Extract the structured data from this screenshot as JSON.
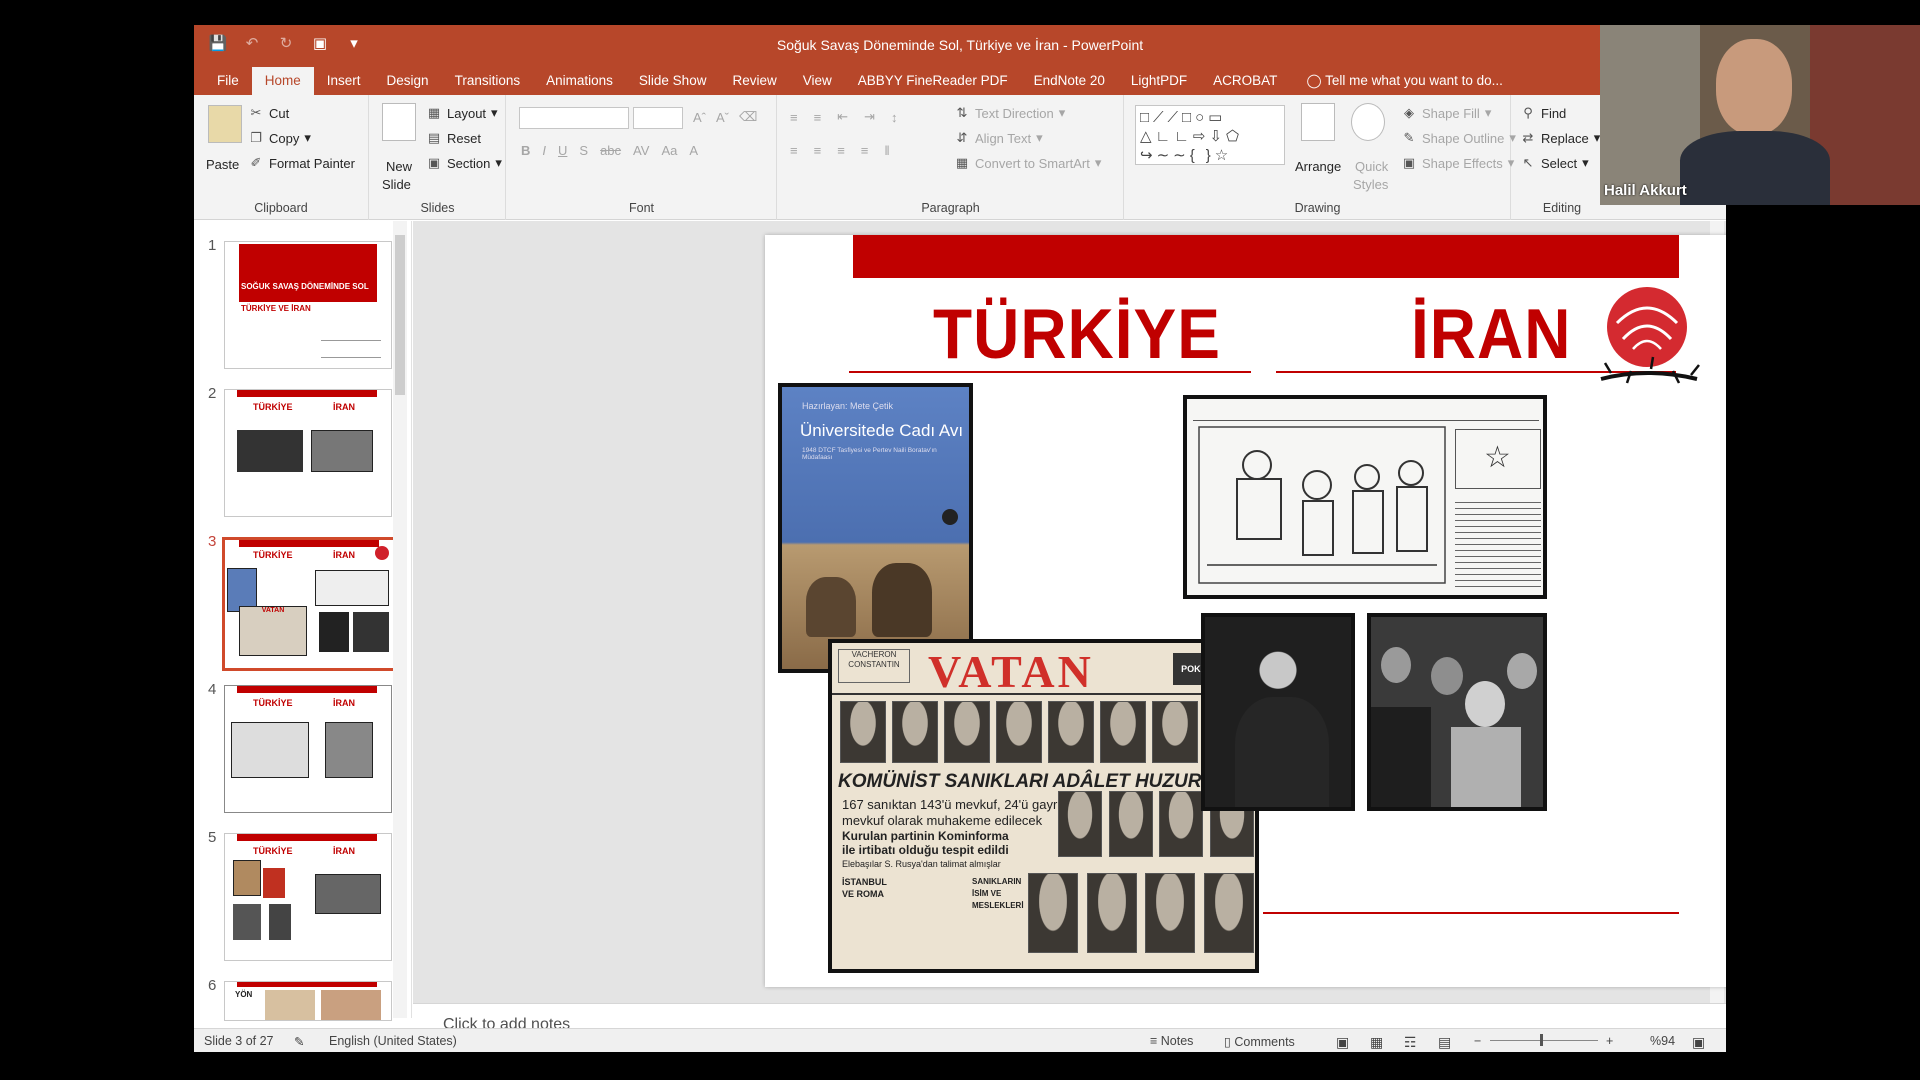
{
  "window": {
    "title": "Soğuk Savaş Döneminde Sol, Türkiye ve İran - PowerPoint"
  },
  "tabs": [
    "File",
    "Home",
    "Insert",
    "Design",
    "Transitions",
    "Animations",
    "Slide Show",
    "Review",
    "View",
    "ABBYY FineReader PDF",
    "EndNote 20",
    "LightPDF",
    "ACROBAT"
  ],
  "active_tab": "Home",
  "tell_me": "Tell me what you want to do...",
  "ribbon": {
    "clipboard": {
      "paste": "Paste",
      "cut": "Cut",
      "copy": "Copy",
      "format_painter": "Format Painter",
      "label": "Clipboard"
    },
    "slides": {
      "new_slide": "New",
      "new_slide2": "Slide",
      "layout": "Layout",
      "reset": "Reset",
      "section": "Section",
      "label": "Slides"
    },
    "font": {
      "label": "Font"
    },
    "paragraph": {
      "text_direction": "Text Direction",
      "align_text": "Align Text",
      "convert_smartart": "Convert to SmartArt",
      "label": "Paragraph"
    },
    "drawing": {
      "arrange": "Arrange",
      "quick_styles": "Quick",
      "quick_styles2": "Styles",
      "shape_fill": "Shape Fill",
      "shape_outline": "Shape Outline",
      "shape_effects": "Shape Effects",
      "label": "Drawing"
    },
    "editing": {
      "find": "Find",
      "replace": "Replace",
      "select": "Select",
      "label": "Editing"
    }
  },
  "thumbnails": [
    {
      "num": "1",
      "title1": "SOĞUK SAVAŞ DÖNEMİNDE SOL",
      "title2": "TÜRKİYE VE İRAN"
    },
    {
      "num": "2",
      "left": "TÜRKİYE",
      "right": "İRAN"
    },
    {
      "num": "3",
      "left": "TÜRKİYE",
      "right": "İRAN",
      "paper": "VATAN"
    },
    {
      "num": "4",
      "left": "TÜRKİYE",
      "right": "İRAN"
    },
    {
      "num": "5",
      "left": "TÜRKİYE",
      "right": "İRAN"
    },
    {
      "num": "6",
      "left": "YÖN"
    }
  ],
  "slide": {
    "left_heading": "TÜRKİYE",
    "right_heading": "İRAN",
    "book": {
      "author": "Hazırlayan: Mete Çetik",
      "title": "Üniversitede Cadı Avı",
      "subtitle": "1948 DTCF Tasfiyesi ve Pertev Naili Boratav'ın Müdafaası"
    },
    "newspaper": {
      "masthead": "VATAN",
      "banner": "KOMÜNİST SANIKLARI ADÂLET HUZURUNDA",
      "line1": "167 sanıktan 143'ü mevkuf, 24'ü gayri",
      "line2": "mevkuf olarak muhakeme edilecek",
      "line3": "Kurulan partinin Kominforma",
      "line4": "ile irtibatı olduğu tespit edildi",
      "line5": "Elebaşılar S. Rusya'dan talimat almışlar",
      "side1": "İSTANBUL",
      "side2": "VE ROMA",
      "side3": "SANIKLARIN",
      "side4": "İSİM VE",
      "side5": "MESLEKLERİ",
      "adv": "POKER PLAY"
    }
  },
  "notes_placeholder": "Click to add notes",
  "status": {
    "slide": "Slide 3 of 27",
    "language": "English (United States)",
    "notes": "Notes",
    "comments": "Comments",
    "zoom": "%94"
  },
  "webcam": {
    "name": "Halil Akkurt"
  },
  "colors": {
    "accent": "#b7472a",
    "slide_red": "#c00000"
  }
}
